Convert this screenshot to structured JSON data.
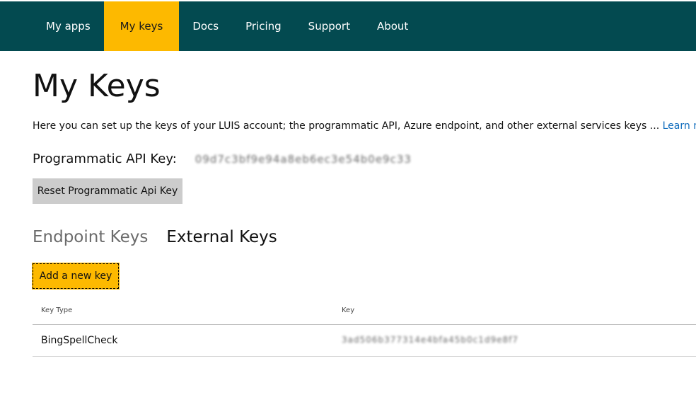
{
  "nav": {
    "items": [
      {
        "label": "My apps",
        "active": false
      },
      {
        "label": "My keys",
        "active": true
      },
      {
        "label": "Docs",
        "active": false
      },
      {
        "label": "Pricing",
        "active": false
      },
      {
        "label": "Support",
        "active": false
      },
      {
        "label": "About",
        "active": false
      }
    ]
  },
  "page": {
    "title": "My Keys",
    "intro": "Here you can set up the keys of your LUIS account; the programmatic API, Azure endpoint, and other external services keys ...",
    "learn_more": "Learn more"
  },
  "programmatic": {
    "label": "Programmatic API Key:",
    "value": "09d7c3bf9e94a8eb6ec3e54b0e9c33",
    "reset_label": "Reset Programmatic Api Key"
  },
  "tabs": [
    {
      "label": "Endpoint Keys",
      "selected": false
    },
    {
      "label": "External Keys",
      "selected": true
    }
  ],
  "add_key_label": "Add a new key",
  "table": {
    "headers": {
      "type": "Key Type",
      "key": "Key"
    },
    "rows": [
      {
        "type": "BingSpellCheck",
        "key": "3ad506b377314e4bfa45b0c1d9e8f7"
      }
    ]
  },
  "colors": {
    "header_bg": "#034a50",
    "accent": "#fdb900",
    "link": "#0f6cbd"
  }
}
